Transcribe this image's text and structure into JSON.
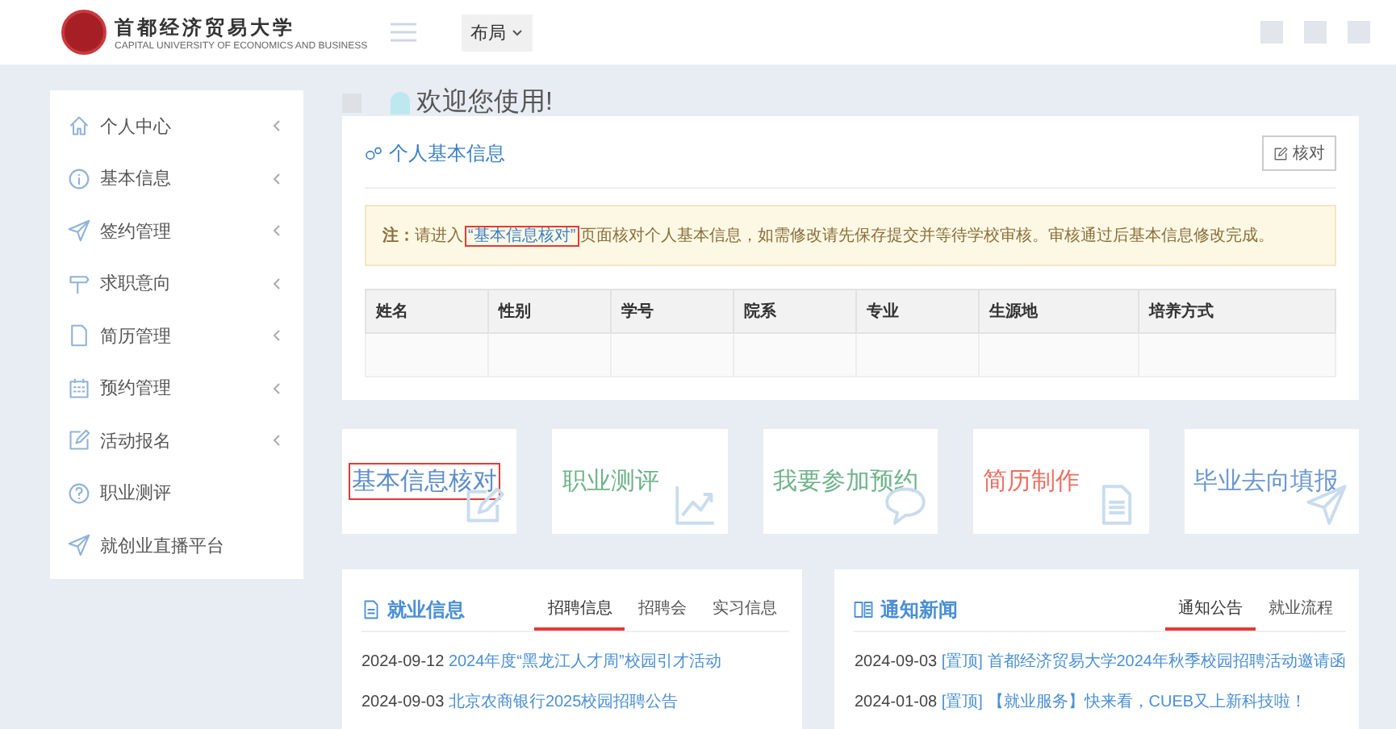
{
  "header": {
    "logo_name": "首都经济贸易大学",
    "logo_subtitle": "CAPITAL UNIVERSITY OF ECONOMICS AND BUSINESS",
    "layout_button": "布局"
  },
  "sidebar": {
    "items": [
      {
        "label": "个人中心",
        "has_submenu": true
      },
      {
        "label": "基本信息",
        "has_submenu": true
      },
      {
        "label": "签约管理",
        "has_submenu": true
      },
      {
        "label": "求职意向",
        "has_submenu": true
      },
      {
        "label": "简历管理",
        "has_submenu": true
      },
      {
        "label": "预约管理",
        "has_submenu": true
      },
      {
        "label": "活动报名",
        "has_submenu": true
      },
      {
        "label": "职业测评",
        "has_submenu": false
      },
      {
        "label": "就创业直播平台",
        "has_submenu": false
      }
    ]
  },
  "welcome": "欢迎您使用!",
  "profile_card": {
    "title": "个人基本信息",
    "verify_button": "核对",
    "notice": {
      "prefix": "注：",
      "before": "请进入",
      "link": "“基本信息核对”",
      "link_highlighted": true,
      "after": "页面核对个人基本信息，如需修改请先保存提交并等待学校审核。审核通过后基本信息修改完成。"
    },
    "table": {
      "columns": [
        "姓名",
        "性别",
        "学号",
        "院系",
        "专业",
        "生源地",
        "培养方式"
      ]
    }
  },
  "tiles": [
    {
      "label": "基本信息核对",
      "color": "#5b8bc9",
      "highlighted": true
    },
    {
      "label": "职业测评",
      "color": "#6fb38a",
      "highlighted": false
    },
    {
      "label": "我要参加预约",
      "color": "#6fb38a",
      "highlighted": false
    },
    {
      "label": "简历制作",
      "color": "#ec6f62",
      "highlighted": false
    },
    {
      "label": "毕业去向填报",
      "color": "#6b97cf",
      "highlighted": false
    }
  ],
  "panels": [
    {
      "title": "就业信息",
      "tabs": [
        {
          "label": "招聘信息",
          "selected": true
        },
        {
          "label": "招聘会",
          "selected": false
        },
        {
          "label": "实习信息",
          "selected": false
        }
      ],
      "items": [
        {
          "date": "2024-09-12",
          "title": "2024年度“黑龙江人才周”校园引才活动"
        },
        {
          "date": "2024-09-03",
          "title": "北京农商银行2025校园招聘公告"
        }
      ]
    },
    {
      "title": "通知新闻",
      "tabs": [
        {
          "label": "通知公告",
          "selected": true
        },
        {
          "label": "就业流程",
          "selected": false
        }
      ],
      "items": [
        {
          "date": "2024-09-03",
          "tag": "[置顶]",
          "title": "首都经济贸易大学2024年秋季校园招聘活动邀请函"
        },
        {
          "date": "2024-01-08",
          "tag": "[置顶]",
          "title": "【就业服务】快来看，CUEB又上新科技啦！"
        }
      ]
    }
  ]
}
